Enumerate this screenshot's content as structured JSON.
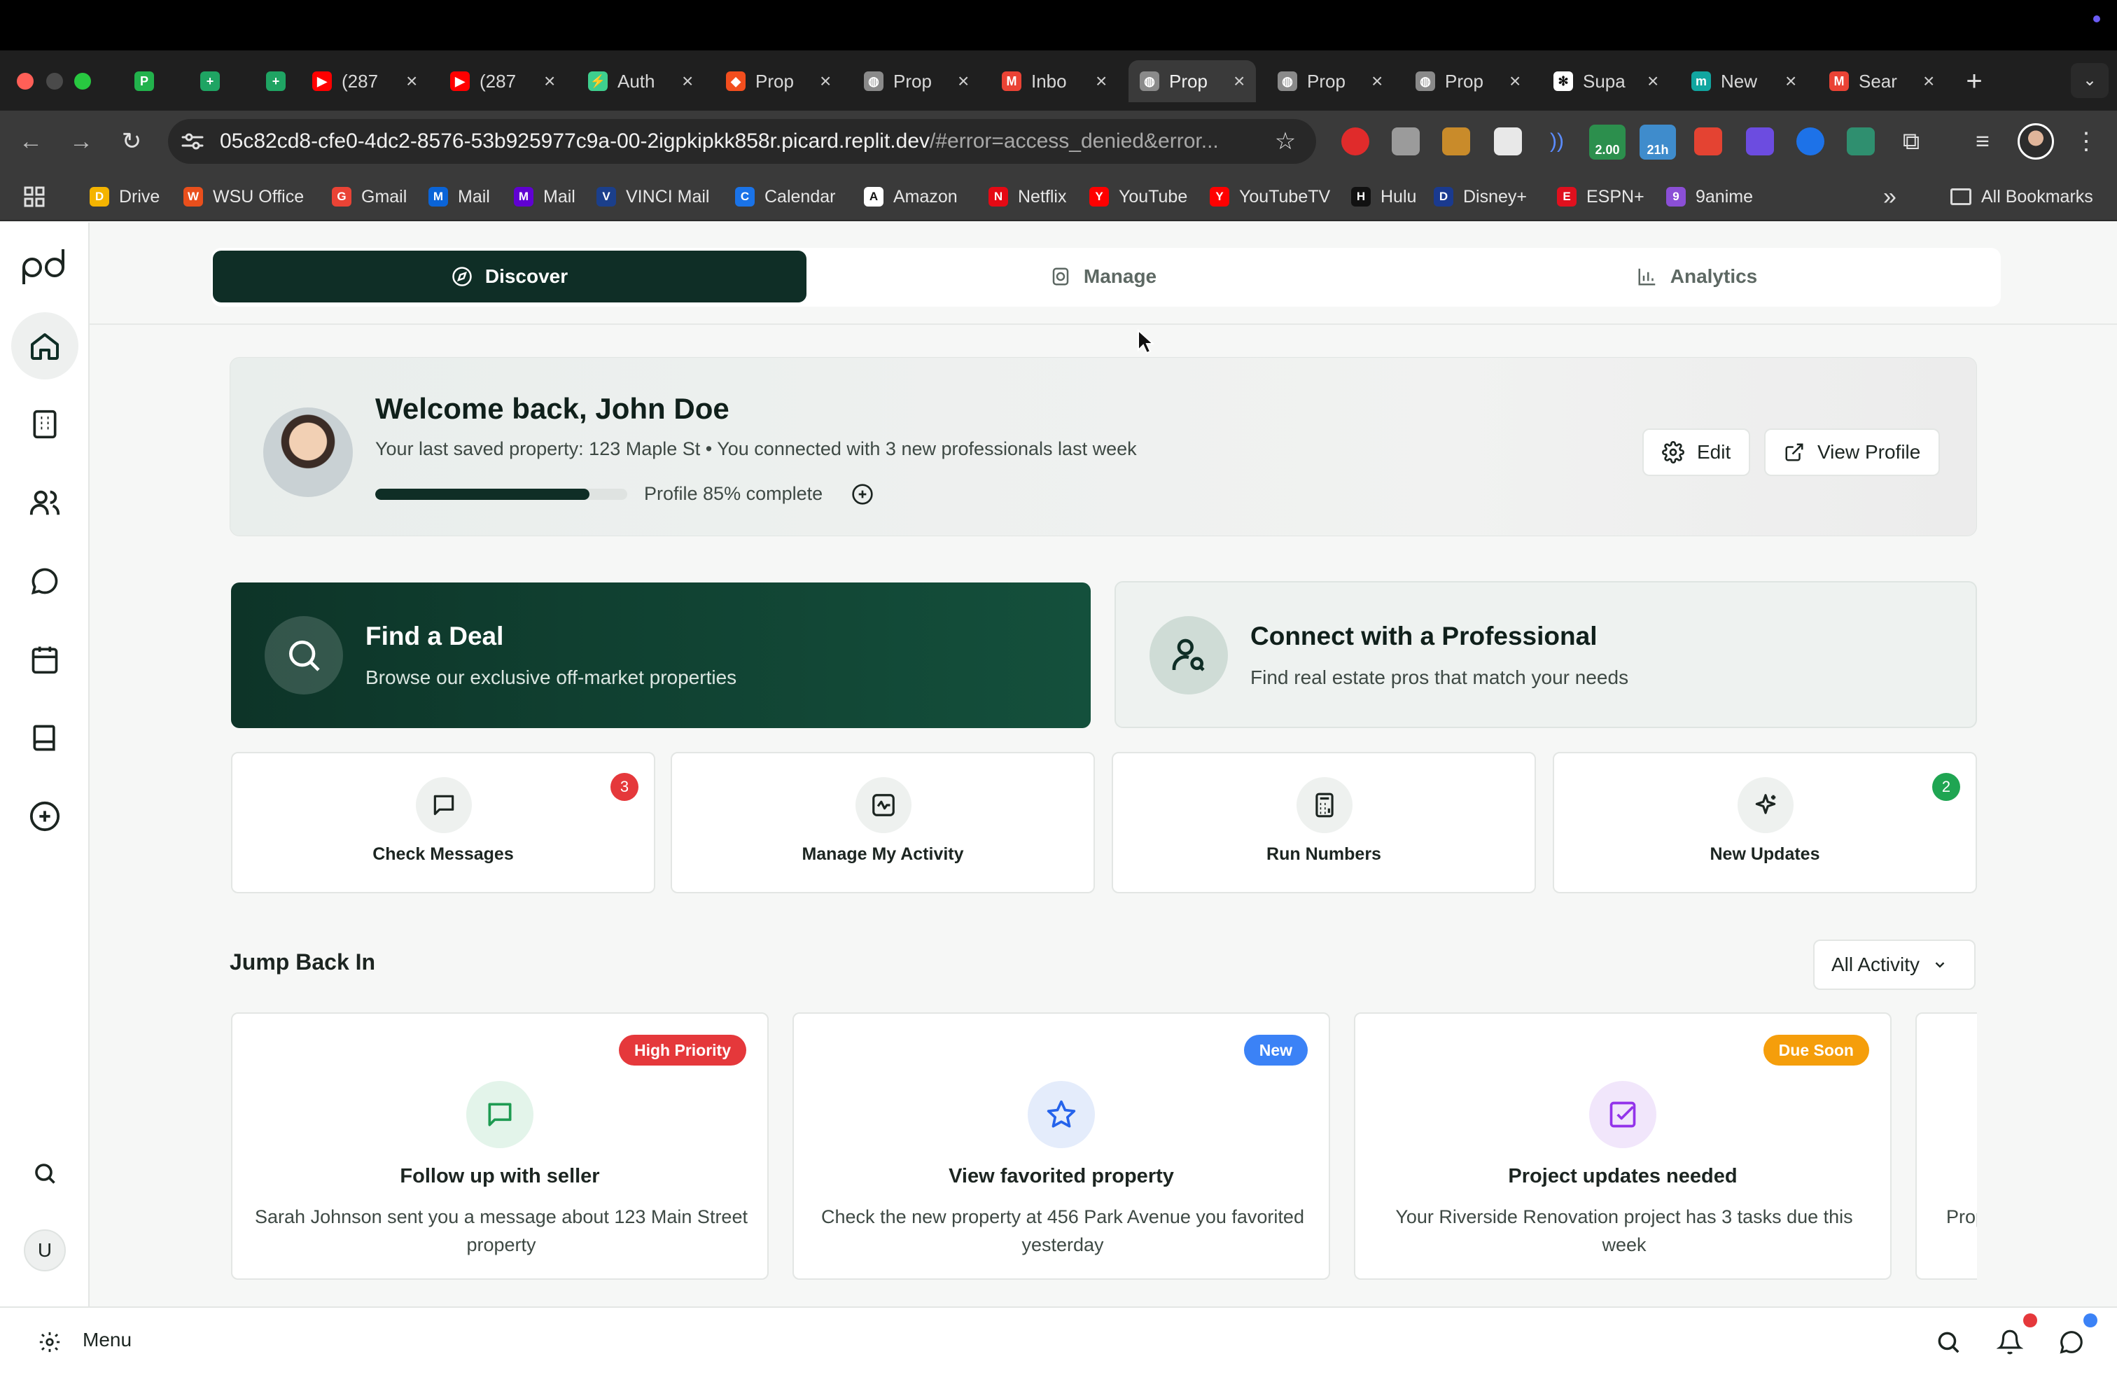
{
  "browser": {
    "tabs": [
      {
        "title": "",
        "favicon": "p-green-icon",
        "color": "#22b24c",
        "char": "P"
      },
      {
        "title": "",
        "favicon": "sheets-icon",
        "color": "#1fa463",
        "char": "+"
      },
      {
        "title": "",
        "favicon": "sheets-icon",
        "color": "#1fa463",
        "char": "+"
      },
      {
        "title": "(287",
        "favicon": "youtube-icon",
        "color": "#ff0000",
        "char": "▶"
      },
      {
        "title": "(287",
        "favicon": "youtube-icon",
        "color": "#ff0000",
        "char": "▶"
      },
      {
        "title": "Auth",
        "favicon": "bolt-icon",
        "color": "#3ecf8e",
        "char": "⚡"
      },
      {
        "title": "Prop",
        "favicon": "figma-icon",
        "color": "#f24e1e",
        "char": "◆"
      },
      {
        "title": "Prop",
        "favicon": "globe-icon",
        "color": "#8a8a8a",
        "char": "◍"
      },
      {
        "title": "Inbo",
        "favicon": "gmail-icon",
        "color": "#ea4335",
        "char": "M"
      },
      {
        "title": "Prop",
        "favicon": "globe-icon",
        "color": "#8a8a8a",
        "char": "◍"
      },
      {
        "title": "Prop",
        "favicon": "globe-icon",
        "color": "#8a8a8a",
        "char": "◍"
      },
      {
        "title": "Prop",
        "favicon": "globe-icon",
        "color": "#8a8a8a",
        "char": "◍"
      },
      {
        "title": "Supa",
        "favicon": "openai-icon",
        "color": "#ffffff",
        "char": "✻"
      },
      {
        "title": "New",
        "favicon": "m-icon",
        "color": "#11a6a0",
        "char": "m"
      },
      {
        "title": "Sear",
        "favicon": "gmail-icon",
        "color": "#ea4335",
        "char": "M"
      }
    ],
    "active_tab_index": 9,
    "url_host": "05c82cd8-cfe0-4dc2-8576-53b925977c9a-00-2igpkipkk858r.picard.replit.dev",
    "url_rest": "/#error=access_denied&error...",
    "ext_badges": {
      "a": "2.00",
      "b": "21h"
    },
    "bookmarks": [
      {
        "label": "Drive",
        "icon": "drive-icon",
        "color": "#f4b400"
      },
      {
        "label": "WSU Office",
        "icon": "office-icon",
        "color": "#e94f1c"
      },
      {
        "label": "Gmail",
        "icon": "gmail-icon",
        "color": "#ea4335"
      },
      {
        "label": "Mail",
        "icon": "outlook-icon",
        "color": "#0a64d8"
      },
      {
        "label": "Mail",
        "icon": "yahoo-icon",
        "color": "#6001d2"
      },
      {
        "label": "VINCI Mail",
        "icon": "vinci-icon",
        "color": "#1b3f8b"
      },
      {
        "label": "Calendar",
        "icon": "calendar-icon",
        "color": "#1a73e8"
      },
      {
        "label": "Amazon",
        "icon": "amazon-icon",
        "color": "#ffffff"
      },
      {
        "label": "Netflix",
        "icon": "netflix-icon",
        "color": "#e50914"
      },
      {
        "label": "YouTube",
        "icon": "youtube-icon",
        "color": "#ff0000"
      },
      {
        "label": "YouTubeTV",
        "icon": "youtube-icon",
        "color": "#ff0000"
      },
      {
        "label": "Hulu",
        "icon": "hulu-icon",
        "color": "#111111"
      },
      {
        "label": "Disney+",
        "icon": "disney-icon",
        "color": "#1a3a8f"
      },
      {
        "label": "ESPN+",
        "icon": "espn-icon",
        "color": "#e0101e"
      },
      {
        "label": "9anime",
        "icon": "9anime-icon",
        "color": "#8b4fd6"
      }
    ],
    "all_bookmarks_label": "All Bookmarks"
  },
  "app": {
    "logo_text": "pd",
    "nav": {
      "discover": "Discover",
      "manage": "Manage",
      "analytics": "Analytics"
    },
    "welcome": {
      "title": "Welcome back, John Doe",
      "subtitle": "Your last saved property: 123 Maple St • You connected with 3 new professionals last week",
      "profile_progress": 0.85,
      "progress_label": "Profile 85% complete",
      "edit_label": "Edit",
      "view_profile_label": "View Profile"
    },
    "hero": {
      "find_deal_title": "Find a Deal",
      "find_deal_sub": "Browse our exclusive off-market properties",
      "connect_title": "Connect with a Professional",
      "connect_sub": "Find real estate pros that match your needs"
    },
    "quick_actions": [
      {
        "label": "Check Messages",
        "badge": "3",
        "badge_color": "#e5383b",
        "icon": "message-icon"
      },
      {
        "label": "Manage My Activity",
        "badge": "",
        "badge_color": "",
        "icon": "activity-icon"
      },
      {
        "label": "Run Numbers",
        "badge": "",
        "badge_color": "",
        "icon": "calculator-icon"
      },
      {
        "label": "New Updates",
        "badge": "2",
        "badge_color": "#1fa552",
        "icon": "sparkles-icon"
      }
    ],
    "jump_back": {
      "title": "Jump Back In",
      "filter_label": "All Activity",
      "cards": [
        {
          "pill": "High Priority",
          "pill_color": "#e5383b",
          "icon": "message-icon",
          "icon_bg": "#e3f4ea",
          "icon_color": "#1e9b52",
          "title": "Follow up with seller",
          "desc": "Sarah Johnson sent you a message about 123 Main Street property"
        },
        {
          "pill": "New",
          "pill_color": "#3b82f6",
          "icon": "star-icon",
          "icon_bg": "#e4ecfb",
          "icon_color": "#2563eb",
          "title": "View favorited property",
          "desc": "Check the new property at 456 Park Avenue you favorited yesterday"
        },
        {
          "pill": "Due Soon",
          "pill_color": "#f59e0b",
          "icon": "checkbox-icon",
          "icon_bg": "#f1e6fb",
          "icon_color": "#9333ea",
          "title": "Project updates needed",
          "desc": "Your Riverside Renovation project has 3 tasks due this week"
        },
        {
          "pill": "",
          "pill_color": "",
          "icon": "",
          "icon_bg": "",
          "icon_color": "",
          "title": "",
          "desc": "Prop"
        }
      ]
    },
    "user_initial": "U",
    "bottom": {
      "menu_label": "Menu"
    },
    "accent": "#0f2e26"
  }
}
